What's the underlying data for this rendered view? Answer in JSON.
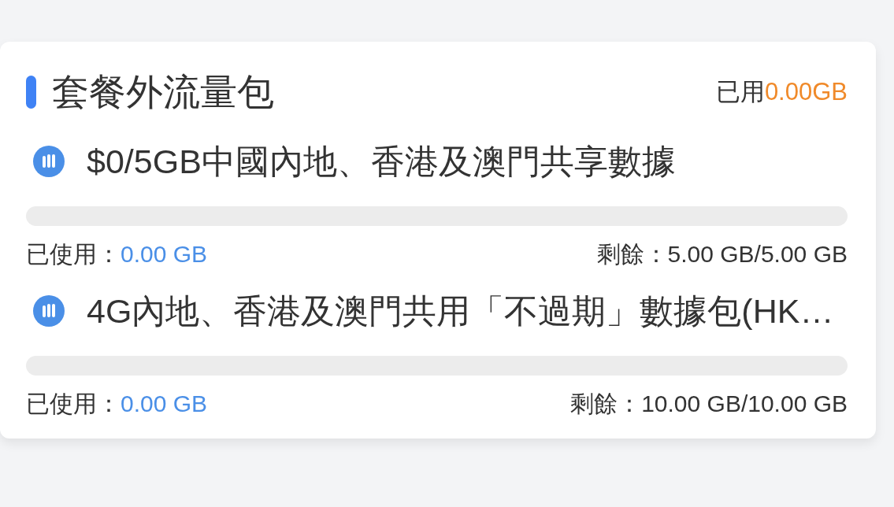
{
  "card": {
    "title": "套餐外流量包",
    "used_label": "已用",
    "used_value": "0.00GB",
    "packages": [
      {
        "name": "$0/5GB中國內地、香港及澳門共享數據",
        "level": 0,
        "used_label": "已使用：",
        "used_value": "0.00 GB",
        "remaining_label": "剩餘：",
        "remaining_value": "5.00 GB/5.00 GB"
      },
      {
        "name": "4G內地、香港及澳門共用「不過期」數據包(HK…",
        "level": 0,
        "used_label": "已使用：",
        "used_value": "0.00 GB",
        "remaining_label": "剩餘：",
        "remaining_value": "10.00 GB/10.00 GB"
      }
    ]
  }
}
